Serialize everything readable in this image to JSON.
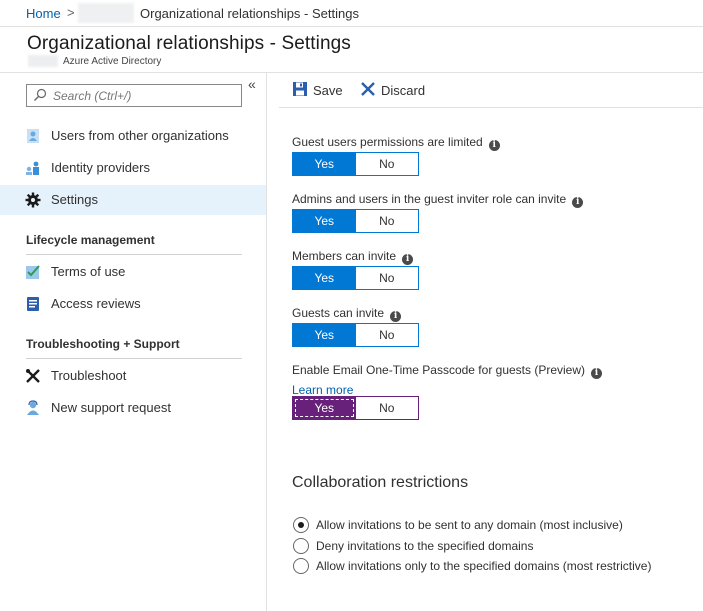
{
  "breadcrumb": {
    "home": "Home",
    "separator": ">",
    "current": "Organizational relationships - Settings"
  },
  "page": {
    "title": "Organizational relationships - Settings",
    "subtitle": "Azure Active Directory"
  },
  "sidebar": {
    "search_placeholder": "Search (Ctrl+/)",
    "collapse": "«",
    "items": [
      {
        "label": "Users from other organizations",
        "icon": "users-icon"
      },
      {
        "label": "Identity providers",
        "icon": "identity-providers-icon"
      },
      {
        "label": "Settings",
        "icon": "gear-icon",
        "active": true
      }
    ],
    "sections": [
      {
        "title": "Lifecycle management",
        "items": [
          {
            "label": "Terms of use",
            "icon": "terms-of-use-icon"
          },
          {
            "label": "Access reviews",
            "icon": "access-reviews-icon"
          }
        ]
      },
      {
        "title": "Troubleshooting + Support",
        "items": [
          {
            "label": "Troubleshoot",
            "icon": "troubleshoot-icon"
          },
          {
            "label": "New support request",
            "icon": "support-request-icon"
          }
        ]
      }
    ]
  },
  "toolbar": {
    "save_label": "Save",
    "discard_label": "Discard"
  },
  "settings": [
    {
      "label": "Guest users permissions are limited",
      "yes": "Yes",
      "no": "No",
      "value": "Yes"
    },
    {
      "label": "Admins and users in the guest inviter role can invite",
      "yes": "Yes",
      "no": "No",
      "value": "Yes"
    },
    {
      "label": "Members can invite",
      "yes": "Yes",
      "no": "No",
      "value": "Yes"
    },
    {
      "label": "Guests can invite",
      "yes": "Yes",
      "no": "No",
      "value": "Yes"
    },
    {
      "label": "Enable Email One-Time Passcode for guests (Preview)",
      "yes": "Yes",
      "no": "No",
      "value": "Yes",
      "link": "Learn more"
    }
  ],
  "info_glyph": "i",
  "collaboration": {
    "title": "Collaboration restrictions",
    "options": [
      {
        "label": "Allow invitations to be sent to any domain (most inclusive)",
        "checked": true
      },
      {
        "label": "Deny invitations to the specified domains",
        "checked": false
      },
      {
        "label": "Allow invitations only to the specified domains (most restrictive)",
        "checked": false
      }
    ]
  },
  "colors": {
    "accent": "#0078d4",
    "preview_toggle": "#68217a",
    "link": "#0062ad",
    "active_nav": "#e5f1fb"
  }
}
